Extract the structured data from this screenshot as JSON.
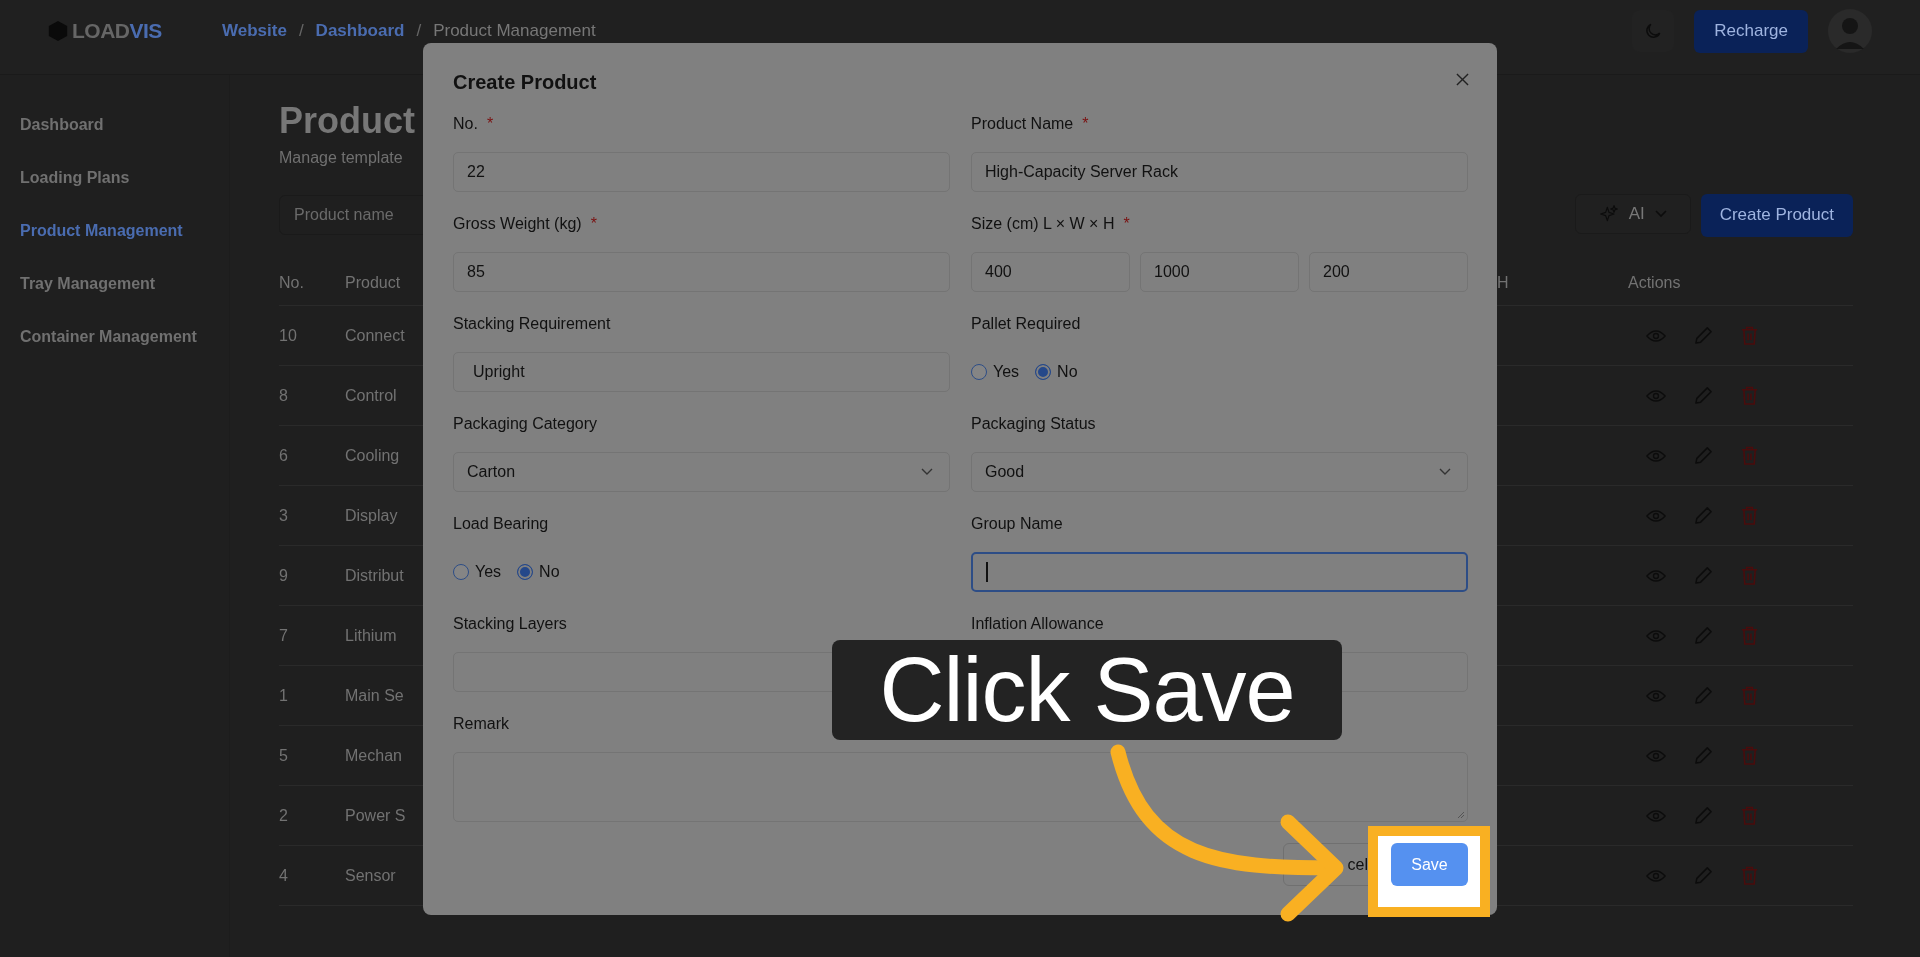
{
  "header": {
    "logo": {
      "part_1": "LOAD",
      "part_2": "VIS"
    },
    "breadcrumb": [
      {
        "label": "Website",
        "current": false
      },
      {
        "label": "Dashboard",
        "current": false
      },
      {
        "label": "Product Management",
        "current": true
      }
    ],
    "separator": "/",
    "recharge": "Recharge"
  },
  "sidebar": {
    "items": [
      {
        "label": "Dashboard",
        "selected": false
      },
      {
        "label": "Loading Plans",
        "selected": false
      },
      {
        "label": "Product Management",
        "selected": true
      },
      {
        "label": "Tray Management",
        "selected": false
      },
      {
        "label": "Container Management",
        "selected": false
      }
    ]
  },
  "page": {
    "title": "Product",
    "subtitle": "Manage template",
    "search_placeholder": "Product name",
    "ai_button": "AI",
    "create_button": "Create Product",
    "table": {
      "columns": [
        "No.",
        "Product",
        "H",
        "Actions"
      ],
      "rows": [
        {
          "no": "10",
          "product": "Connect"
        },
        {
          "no": "8",
          "product": "Control"
        },
        {
          "no": "6",
          "product": "Cooling"
        },
        {
          "no": "3",
          "product": "Display"
        },
        {
          "no": "9",
          "product": "Distribut"
        },
        {
          "no": "7",
          "product": "Lithium"
        },
        {
          "no": "1",
          "product": "Main Se"
        },
        {
          "no": "5",
          "product": "Mechan"
        },
        {
          "no": "2",
          "product": "Power S"
        },
        {
          "no": "4",
          "product": "Sensor"
        }
      ]
    }
  },
  "modal": {
    "title": "Create Product",
    "fields": [
      {
        "kind": "input",
        "label": "No.",
        "required": true,
        "value": "22"
      },
      {
        "kind": "input",
        "label": "Product Name",
        "required": true,
        "value": "High-Capacity Server Rack"
      },
      {
        "kind": "input",
        "label": "Gross Weight (kg)",
        "required": true,
        "value": "85"
      },
      {
        "kind": "size",
        "label": "Size (cm) L × W × H",
        "required": true,
        "values": [
          "400",
          "1000",
          "200"
        ]
      },
      {
        "kind": "input",
        "label": "Stacking Requirement",
        "required": false,
        "value": "Upright"
      },
      {
        "kind": "radio",
        "label": "Pallet Required",
        "required": false,
        "options": [
          {
            "label": "Yes",
            "selected": false
          },
          {
            "label": "No",
            "selected": true
          }
        ]
      },
      {
        "kind": "select",
        "label": "Packaging Category",
        "required": false,
        "value": "Carton"
      },
      {
        "kind": "select",
        "label": "Packaging Status",
        "required": false,
        "value": "Good"
      },
      {
        "kind": "radio",
        "label": "Load Bearing",
        "required": false,
        "options": [
          {
            "label": "Yes",
            "selected": false
          },
          {
            "label": "No",
            "selected": true
          }
        ]
      },
      {
        "kind": "input",
        "label": "Group Name",
        "required": false,
        "focused": true
      },
      {
        "kind": "input",
        "label": "Stacking Layers",
        "required": false
      },
      {
        "kind": "input",
        "label": "Inflation Allowance",
        "required": false
      },
      {
        "kind": "textarea",
        "label": "Remark",
        "required": false
      }
    ],
    "required_mark": "*",
    "cancel": "cel",
    "save": "Save"
  },
  "callout": {
    "text": "Click Save"
  }
}
